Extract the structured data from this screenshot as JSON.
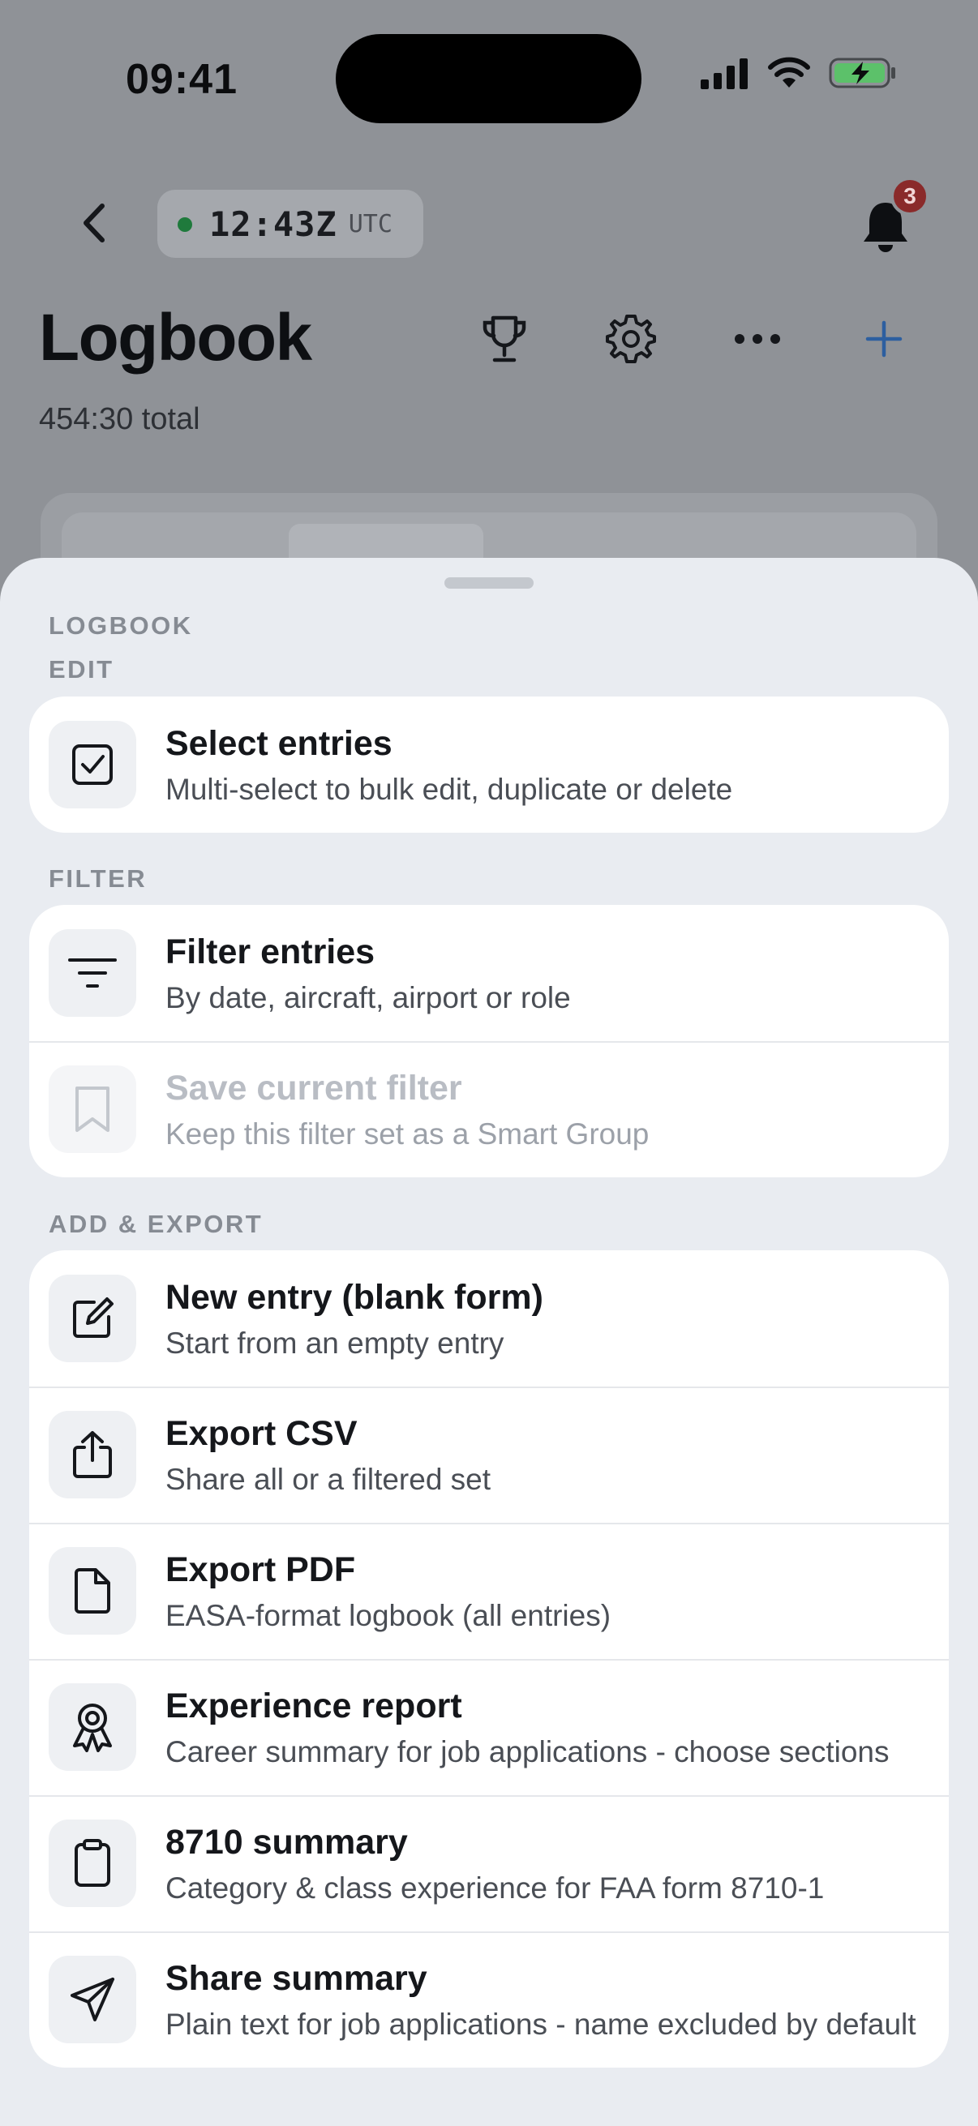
{
  "status_bar": {
    "time": "09:41"
  },
  "nav": {
    "utc_time": "12:43Z",
    "utc_label": "UTC",
    "notification_count": "3"
  },
  "header": {
    "title": "Logbook",
    "total": "454:30 total"
  },
  "sheet": {
    "title": "LOGBOOK",
    "sections": [
      {
        "label": "EDIT",
        "items": [
          {
            "icon": "checkbox-icon",
            "title": "Select entries",
            "subtitle": "Multi-select to bulk edit, duplicate or delete",
            "enabled": true
          }
        ]
      },
      {
        "label": "FILTER",
        "items": [
          {
            "icon": "filter-icon",
            "title": "Filter entries",
            "subtitle": "By date, aircraft, airport or role",
            "enabled": true
          },
          {
            "icon": "bookmark-icon",
            "title": "Save current filter",
            "subtitle": "Keep this filter set as a Smart Group",
            "enabled": false
          }
        ]
      },
      {
        "label": "ADD & EXPORT",
        "items": [
          {
            "icon": "compose-icon",
            "title": "New entry (blank form)",
            "subtitle": "Start from an empty entry",
            "enabled": true
          },
          {
            "icon": "share-icon",
            "title": "Export CSV",
            "subtitle": "Share all or a filtered set",
            "enabled": true
          },
          {
            "icon": "document-icon",
            "title": "Export PDF",
            "subtitle": "EASA-format logbook (all entries)",
            "enabled": true
          },
          {
            "icon": "award-icon",
            "title": "Experience report",
            "subtitle": "Career summary for job applications - choose sections",
            "enabled": true
          },
          {
            "icon": "clipboard-icon",
            "title": "8710 summary",
            "subtitle": "Category & class experience for FAA form 8710-1",
            "enabled": true
          },
          {
            "icon": "send-icon",
            "title": "Share summary",
            "subtitle": "Plain text for job applications - name excluded by default",
            "enabled": true
          }
        ]
      }
    ]
  },
  "colors": {
    "accent": "#2d5fa0",
    "status_green": "#1f7a3c",
    "badge_red": "#8a2a2a",
    "battery_green": "#5cc16a"
  }
}
